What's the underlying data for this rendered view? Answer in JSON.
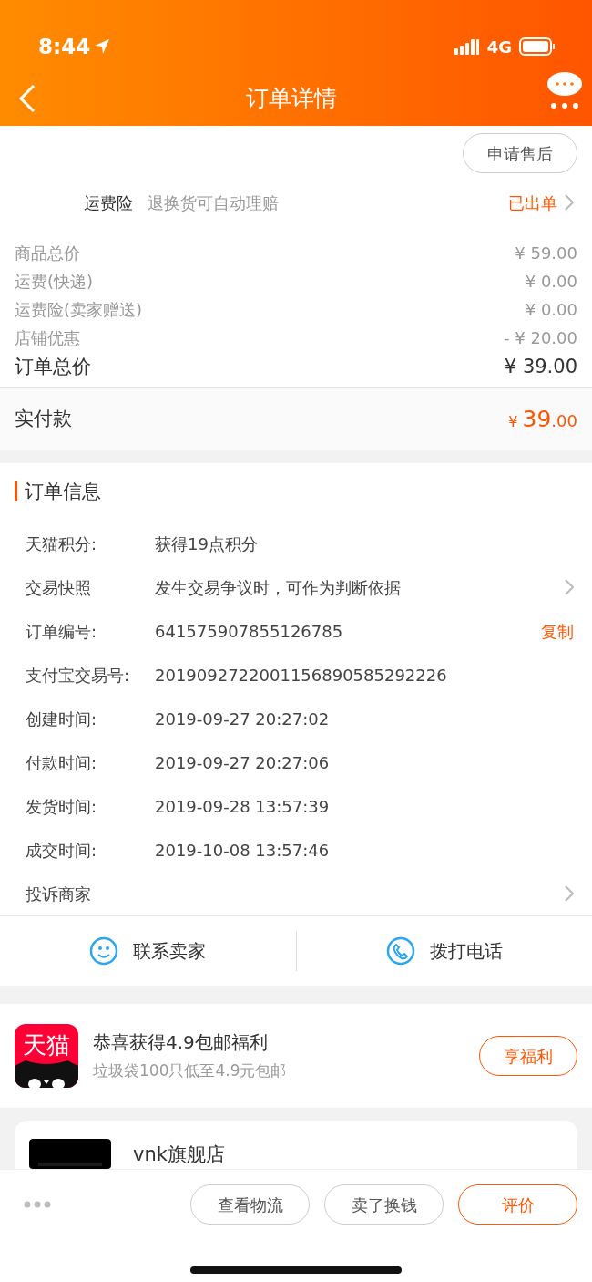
{
  "status_bar": {
    "time": "8:44",
    "network": "4G"
  },
  "nav": {
    "title": "订单详情"
  },
  "after_sale_button": "申请售后",
  "insurance": {
    "label": "运费险",
    "description": "退换货可自动理赔",
    "status": "已出单"
  },
  "prices": [
    {
      "label": "商品总价",
      "value": "¥ 59.00",
      "kind": "minor"
    },
    {
      "label": "运费(快递)",
      "value": "¥ 0.00",
      "kind": "minor"
    },
    {
      "label": "运费险(卖家赠送)",
      "value": "¥ 0.00",
      "kind": "minor"
    },
    {
      "label": "店铺优惠",
      "value": "- ¥ 20.00",
      "kind": "minor"
    },
    {
      "label": "订单总价",
      "value": "¥ 39.00",
      "kind": "total"
    }
  ],
  "paid": {
    "label": "实付款",
    "currency": "¥ ",
    "amount": "39",
    "cents": ".00"
  },
  "order_info": {
    "title": "订单信息",
    "rows": [
      {
        "label": "天猫积分:",
        "value": "获得19点积分",
        "kind": "plain"
      },
      {
        "label": "交易快照",
        "value": "发生交易争议时，可作为判断依据",
        "kind": "chevron"
      },
      {
        "label": "订单编号:",
        "value": "641575907855126785",
        "kind": "copy",
        "action": "复制"
      },
      {
        "label": "支付宝交易号:",
        "value": "2019092722001156890585292226",
        "kind": "plain"
      },
      {
        "label": "创建时间:",
        "value": "2019-09-27 20:27:02",
        "kind": "plain"
      },
      {
        "label": "付款时间:",
        "value": "2019-09-27 20:27:06",
        "kind": "plain"
      },
      {
        "label": "发货时间:",
        "value": "2019-09-28 13:57:39",
        "kind": "plain"
      },
      {
        "label": "成交时间:",
        "value": "2019-10-08 13:57:46",
        "kind": "plain"
      },
      {
        "label": "投诉商家",
        "kind": "chevron"
      }
    ]
  },
  "contact": [
    {
      "label": "联系卖家",
      "kind": "chat"
    },
    {
      "label": "拨打电话",
      "kind": "phone"
    }
  ],
  "promo": {
    "logo_text": "天猫",
    "title": "恭喜获得4.9包邮福利",
    "subtitle": "垃圾袋100只低至4.9元包邮",
    "button": "享福利"
  },
  "store": {
    "name": "vnk旗舰店"
  },
  "footer_buttons": [
    {
      "label": "查看物流",
      "highlighted": false
    },
    {
      "label": "卖了换钱",
      "highlighted": false
    },
    {
      "label": "评价",
      "highlighted": true
    }
  ]
}
